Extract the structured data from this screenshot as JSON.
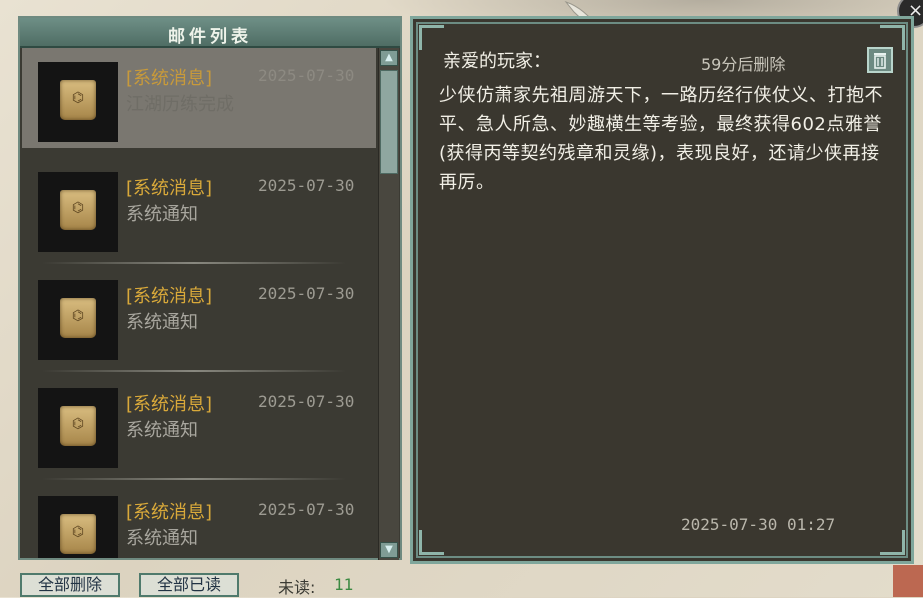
{
  "window": {
    "close_glyph": "×"
  },
  "list_panel": {
    "title": "邮件列表",
    "items": [
      {
        "tag": "[系统消息]",
        "date": "2025-07-30",
        "subject": "江湖历练完成",
        "selected": true,
        "icon": "mail-seal-icon"
      },
      {
        "tag": "[系统消息]",
        "date": "2025-07-30",
        "subject": "系统通知",
        "selected": false,
        "icon": "mail-seal-icon"
      },
      {
        "tag": "[系统消息]",
        "date": "2025-07-30",
        "subject": "系统通知",
        "selected": false,
        "icon": "mail-seal-icon"
      },
      {
        "tag": "[系统消息]",
        "date": "2025-07-30",
        "subject": "系统通知",
        "selected": false,
        "icon": "mail-seal-icon"
      },
      {
        "tag": "[系统消息]",
        "date": "2025-07-30",
        "subject": "系统通知",
        "selected": false,
        "icon": "mail-seal-icon"
      }
    ]
  },
  "detail": {
    "greeting": "亲爱的玩家：",
    "expire": "59分后删除",
    "body": "少侠仿萧家先祖周游天下，一路历经行侠仗义、打抱不平、急人所急、妙趣横生等考验，最终获得602点雅誉(获得丙等契约残章和灵缘)，表现良好，还请少侠再接再厉。",
    "timestamp": "2025-07-30  01:27"
  },
  "footer": {
    "delete_all": "全部删除",
    "read_all": "全部已读",
    "unread_label": "未读:",
    "unread_count": "11"
  },
  "colors": {
    "tag": "#d9a93a",
    "unread": "#3c8a42",
    "frame": "#7fa69b"
  }
}
